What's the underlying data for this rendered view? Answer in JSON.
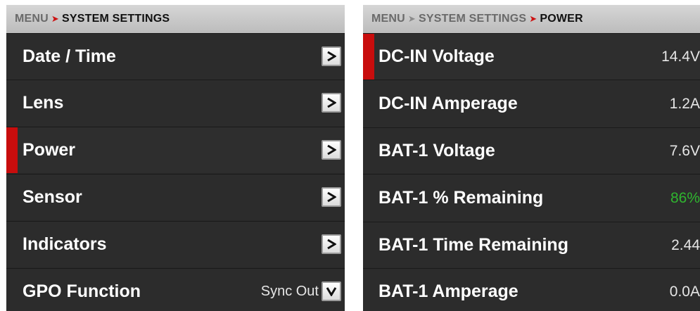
{
  "left_panel": {
    "breadcrumb": {
      "root": "MENU",
      "current": "SYSTEM SETTINGS"
    },
    "items": [
      {
        "label": "Date / Time"
      },
      {
        "label": "Lens"
      },
      {
        "label": "Power"
      },
      {
        "label": "Sensor"
      },
      {
        "label": "Indicators"
      },
      {
        "label": "GPO Function",
        "value": "Sync Out"
      }
    ]
  },
  "right_panel": {
    "breadcrumb": {
      "root": "MENU",
      "middle": "SYSTEM SETTINGS",
      "current": "POWER"
    },
    "items": [
      {
        "label": "DC-IN Voltage",
        "value": "14.4V"
      },
      {
        "label": "DC-IN Amperage",
        "value": "1.2A"
      },
      {
        "label": "BAT-1 Voltage",
        "value": "7.6V"
      },
      {
        "label": "BAT-1 % Remaining",
        "value": "86%"
      },
      {
        "label": "BAT-1 Time Remaining",
        "value": "2.44"
      },
      {
        "label": "BAT-1 Amperage",
        "value": "0.0A"
      }
    ]
  },
  "colors": {
    "selection": "#c80d0d",
    "breadcrumb_arrow": "#cc1111",
    "good_value": "#2fb52f",
    "value_text": "#e6e6e6"
  },
  "icons": {
    "submenu": "chevron-right-icon",
    "dropdown": "chevron-down-icon",
    "breadcrumb_separator": "arrow-right-icon"
  }
}
